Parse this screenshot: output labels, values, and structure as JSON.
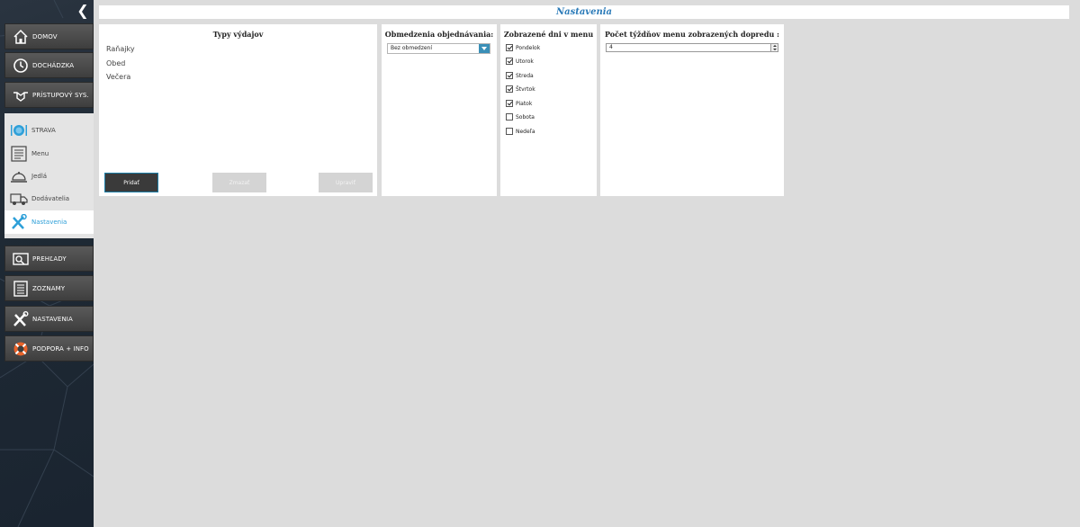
{
  "app": {
    "page_title": "Nastavenia",
    "accent_color": "#2d9fd8"
  },
  "sidebar": {
    "collapse_icon": "chevron-left-icon",
    "top_items": [
      {
        "label": "DOMOV",
        "icon": "home-icon"
      },
      {
        "label": "DOCHÁDZKA",
        "icon": "clock-icon"
      },
      {
        "label": "PRÍSTUPOVÝ SYS.",
        "icon": "handshake-icon"
      }
    ],
    "submenu": {
      "header": {
        "label": "STRAVA",
        "icon": "plate-icon"
      },
      "items": [
        {
          "label": "Menu",
          "icon": "menu-icon"
        },
        {
          "label": "Jedlá",
          "icon": "cloche-icon"
        },
        {
          "label": "Dodávatelia",
          "icon": "truck-icon"
        },
        {
          "label": "Nastavenia",
          "icon": "tools-icon",
          "active": true
        }
      ]
    },
    "bottom_items": [
      {
        "label": "PREHĽADY",
        "icon": "overview-icon"
      },
      {
        "label": "ZOZNAMY",
        "icon": "list-icon"
      },
      {
        "label": "NASTAVENIA",
        "icon": "tools-icon"
      },
      {
        "label": "PODPORA + INFO",
        "icon": "lifebuoy-icon"
      }
    ]
  },
  "types_panel": {
    "title": "Typy výdajov",
    "items": [
      "Raňajky",
      "Obed",
      "Večera"
    ],
    "buttons": {
      "add": "Pridať",
      "delete": "Zmazať",
      "edit": "Upraviť"
    }
  },
  "limits_panel": {
    "title": "Obmedzenia objednávania:",
    "selected": "Bez obmedzení"
  },
  "days_panel": {
    "title": "Zobrazené dni v menu",
    "days": [
      {
        "label": "Pondelok",
        "checked": true
      },
      {
        "label": "Utorok",
        "checked": true
      },
      {
        "label": "Streda",
        "checked": true
      },
      {
        "label": "Štvrtok",
        "checked": true
      },
      {
        "label": "Piatok",
        "checked": true
      },
      {
        "label": "Sobota",
        "checked": false
      },
      {
        "label": "Nedeľa",
        "checked": false
      }
    ]
  },
  "weeks_panel": {
    "title": "Počet týždňov menu zobrazených dopredu :",
    "value": "4"
  }
}
